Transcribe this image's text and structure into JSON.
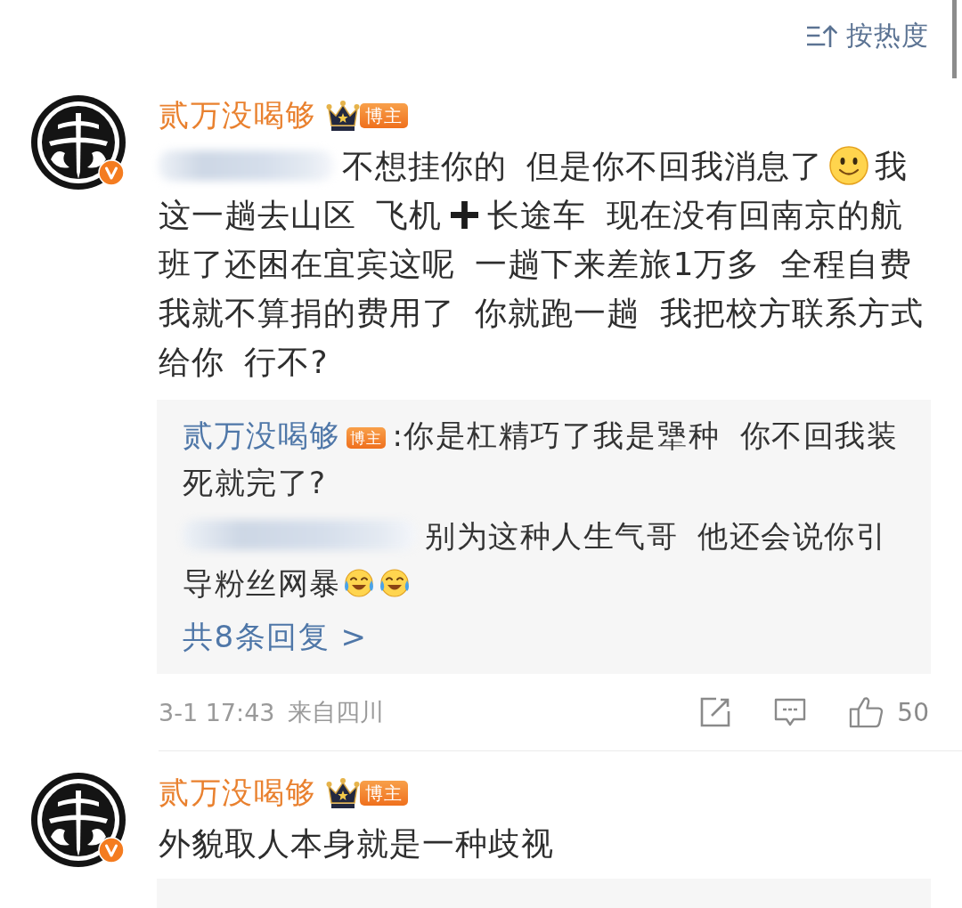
{
  "sort_button": {
    "label": "按热度"
  },
  "comments": [
    {
      "author": "贰万没喝够",
      "verified": true,
      "crown": true,
      "badge": "博主",
      "content": [
        {
          "kind": "redacted"
        },
        {
          "kind": "text",
          "text": "不想挂你的 但是你不回我消息了"
        },
        {
          "kind": "smile_emoji"
        },
        {
          "kind": "text",
          "text": "我这一趟去山区 飞机"
        },
        {
          "kind": "plus_emoji"
        },
        {
          "kind": "text",
          "text": "长途车 现在没有回南京的航班了还困在宜宾这呢 一趟下来差旅1万多 全程自费我就不算捐的费用了 你就跑一趟 我把校方联系方式给你 行不?"
        }
      ],
      "replies": [
        {
          "author": "贰万没喝够",
          "badge": "博主",
          "content": [
            {
              "kind": "text",
              "text": ":你是杠精巧了我是犟种 你不回我装死就完了?"
            }
          ]
        },
        {
          "content": [
            {
              "kind": "redacted"
            },
            {
              "kind": "text",
              "text": "别为这种人生气哥 他还会说你引导粉丝网暴"
            },
            {
              "kind": "laugh_cry_emoji"
            },
            {
              "kind": "laugh_cry_emoji"
            }
          ]
        }
      ],
      "more_replies": "共8条回复 >",
      "time": "3-1 17:43",
      "location": "来自四川",
      "like_count": "50"
    },
    {
      "author": "贰万没喝够",
      "verified": true,
      "crown": true,
      "badge": "博主",
      "content": [
        {
          "kind": "text",
          "text": "外貌取人本身就是一种歧视"
        }
      ],
      "reply_box": true
    }
  ]
}
